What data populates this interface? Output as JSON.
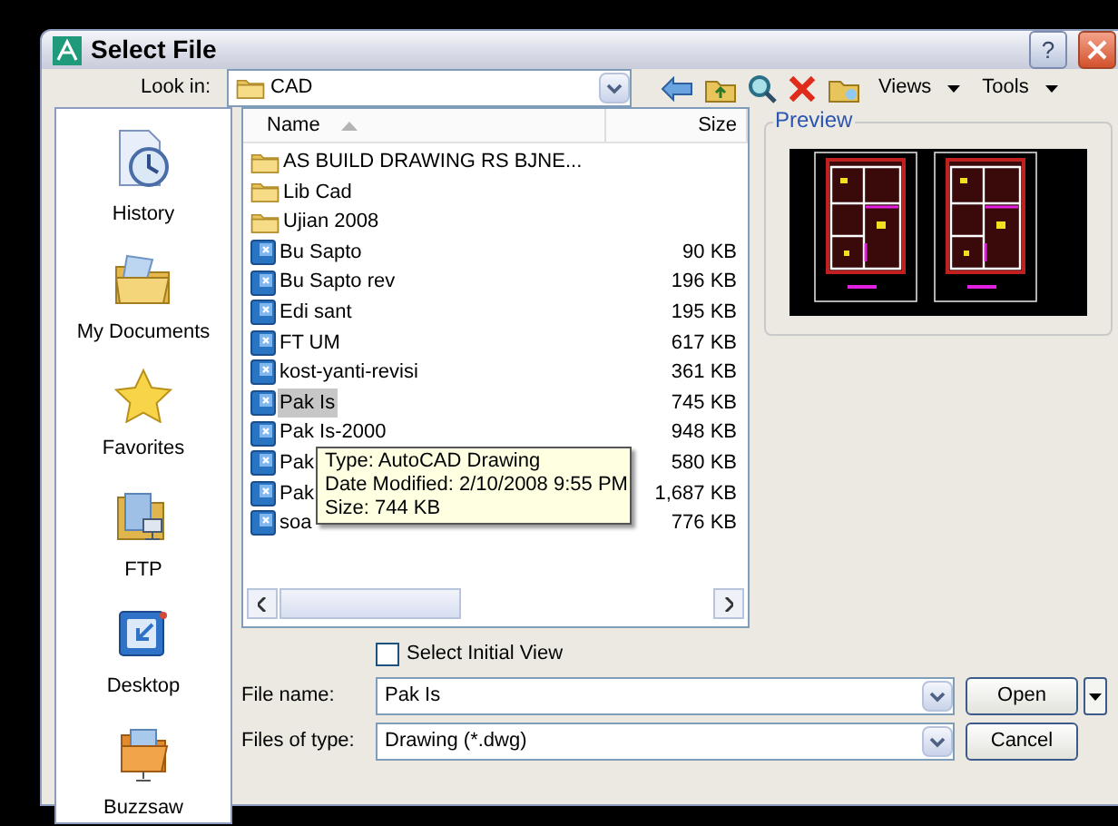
{
  "window": {
    "title": "Select File",
    "help": "?"
  },
  "look_in": {
    "label": "Look in:",
    "value": "CAD"
  },
  "toolbar": {
    "menus": [
      "Views",
      "Tools"
    ]
  },
  "places": [
    {
      "label": "History",
      "kind": "history"
    },
    {
      "label": "My Documents",
      "kind": "documents"
    },
    {
      "label": "Favorites",
      "kind": "favorites"
    },
    {
      "label": "FTP",
      "kind": "ftp"
    },
    {
      "label": "Desktop",
      "kind": "desktop"
    },
    {
      "label": "Buzzsaw",
      "kind": "buzzsaw"
    }
  ],
  "file_list": {
    "columns": [
      "Name",
      "Size"
    ],
    "rows": [
      {
        "name": "AS BUILD DRAWING RS BJNE...",
        "kind": "folder",
        "selected": false
      },
      {
        "name": "Lib Cad",
        "kind": "folder",
        "selected": false
      },
      {
        "name": "Ujian 2008",
        "kind": "folder",
        "selected": false
      },
      {
        "name": "Bu Sapto",
        "size": "90 KB",
        "kind": "drawing",
        "selected": false
      },
      {
        "name": "Bu Sapto rev",
        "size": "196 KB",
        "kind": "drawing",
        "selected": false
      },
      {
        "name": "Edi sant",
        "size": "195 KB",
        "kind": "drawing",
        "selected": false
      },
      {
        "name": "FT UM",
        "size": "617 KB",
        "kind": "drawing",
        "selected": false
      },
      {
        "name": "kost-yanti-revisi",
        "size": "361 KB",
        "kind": "drawing",
        "selected": false
      },
      {
        "name": "Pak Is",
        "size": "745 KB",
        "kind": "drawing",
        "selected": true
      },
      {
        "name": "Pak Is-2000",
        "size": "948 KB",
        "kind": "drawing",
        "selected": false
      },
      {
        "name": "Pak",
        "size": "580 KB",
        "kind": "drawing",
        "selected": false
      },
      {
        "name": "Pak",
        "size": "1,687 KB",
        "kind": "drawing",
        "selected": false
      },
      {
        "name": "soa",
        "size": "776 KB",
        "kind": "drawing",
        "selected": false
      }
    ]
  },
  "tooltip": {
    "lines": [
      "Type: AutoCAD Drawing",
      "Date Modified: 2/10/2008 9:55 PM",
      "Size: 744 KB"
    ]
  },
  "preview": {
    "label": "Preview"
  },
  "select_initial_view": {
    "label": "Select Initial View",
    "checked": false
  },
  "file_name": {
    "label": "File name:",
    "value": "Pak Is"
  },
  "files_of_type": {
    "label": "Files of type:",
    "value": "Drawing (*.dwg)"
  },
  "buttons": [
    "Open",
    "Cancel"
  ]
}
